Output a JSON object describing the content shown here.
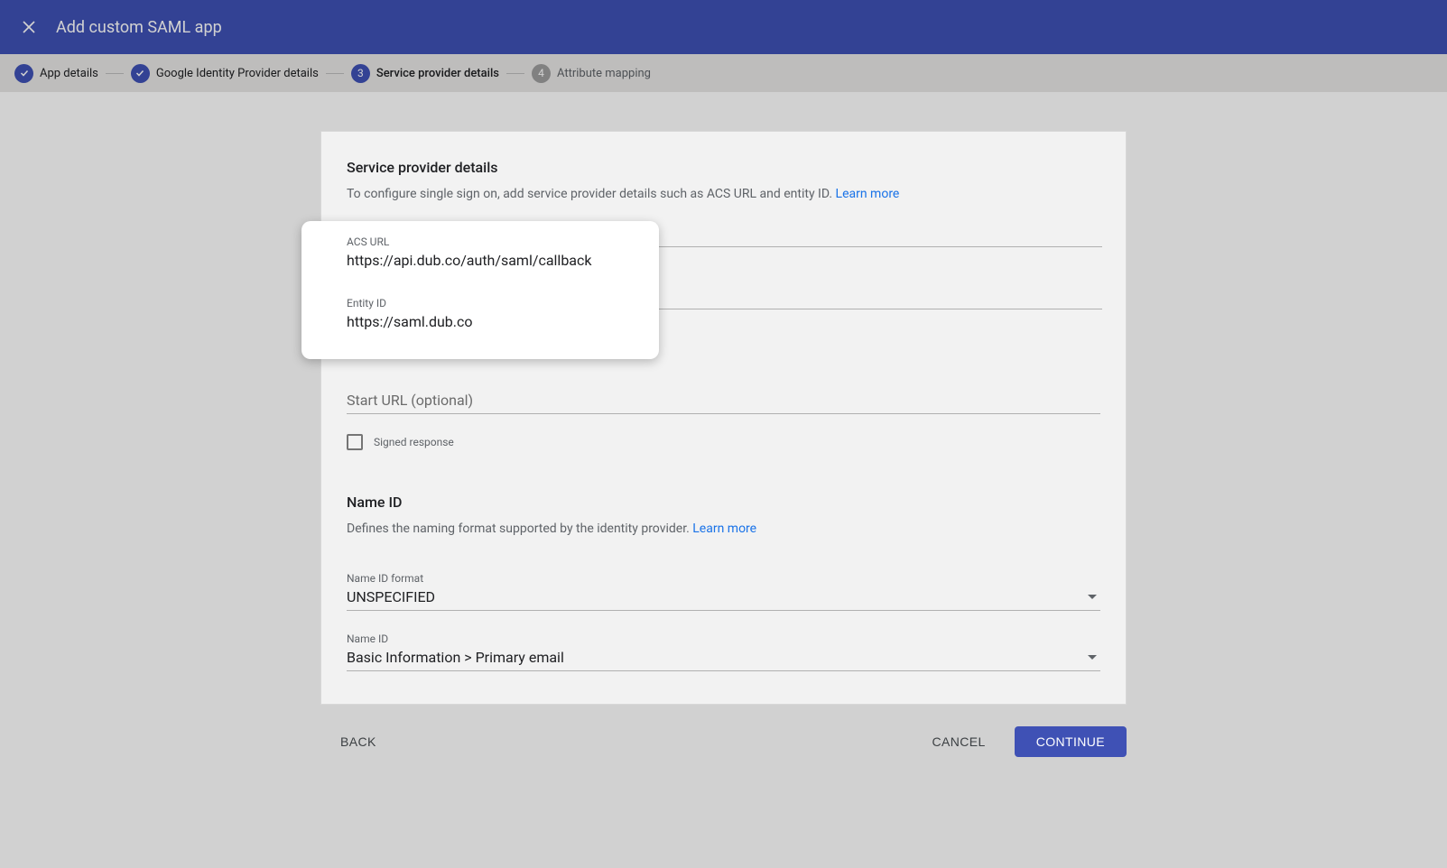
{
  "header": {
    "title": "Add custom SAML app"
  },
  "stepper": {
    "steps": [
      {
        "label": "App details",
        "state": "done"
      },
      {
        "label": "Google Identity Provider details",
        "state": "done"
      },
      {
        "label": "Service provider details",
        "state": "active",
        "num": "3"
      },
      {
        "label": "Attribute mapping",
        "state": "pending",
        "num": "4"
      }
    ]
  },
  "section1": {
    "title": "Service provider details",
    "desc": "To configure single sign on, add service provider details such as ACS URL and entity ID. ",
    "learn": "Learn more"
  },
  "fields": {
    "acs_label": "ACS URL",
    "acs_value": "https://api.dub.co/auth/saml/callback",
    "entity_label": "Entity ID",
    "entity_value": "https://saml.dub.co",
    "start_placeholder": "Start URL (optional)",
    "signed_label": "Signed response"
  },
  "section2": {
    "title": "Name ID",
    "desc": "Defines the naming format supported by the identity provider. ",
    "learn": "Learn more"
  },
  "selects": {
    "format_label": "Name ID format",
    "format_value": "UNSPECIFIED",
    "nameid_label": "Name ID",
    "nameid_value": "Basic Information > Primary email"
  },
  "footer": {
    "back": "BACK",
    "cancel": "CANCEL",
    "continue": "CONTINUE"
  }
}
